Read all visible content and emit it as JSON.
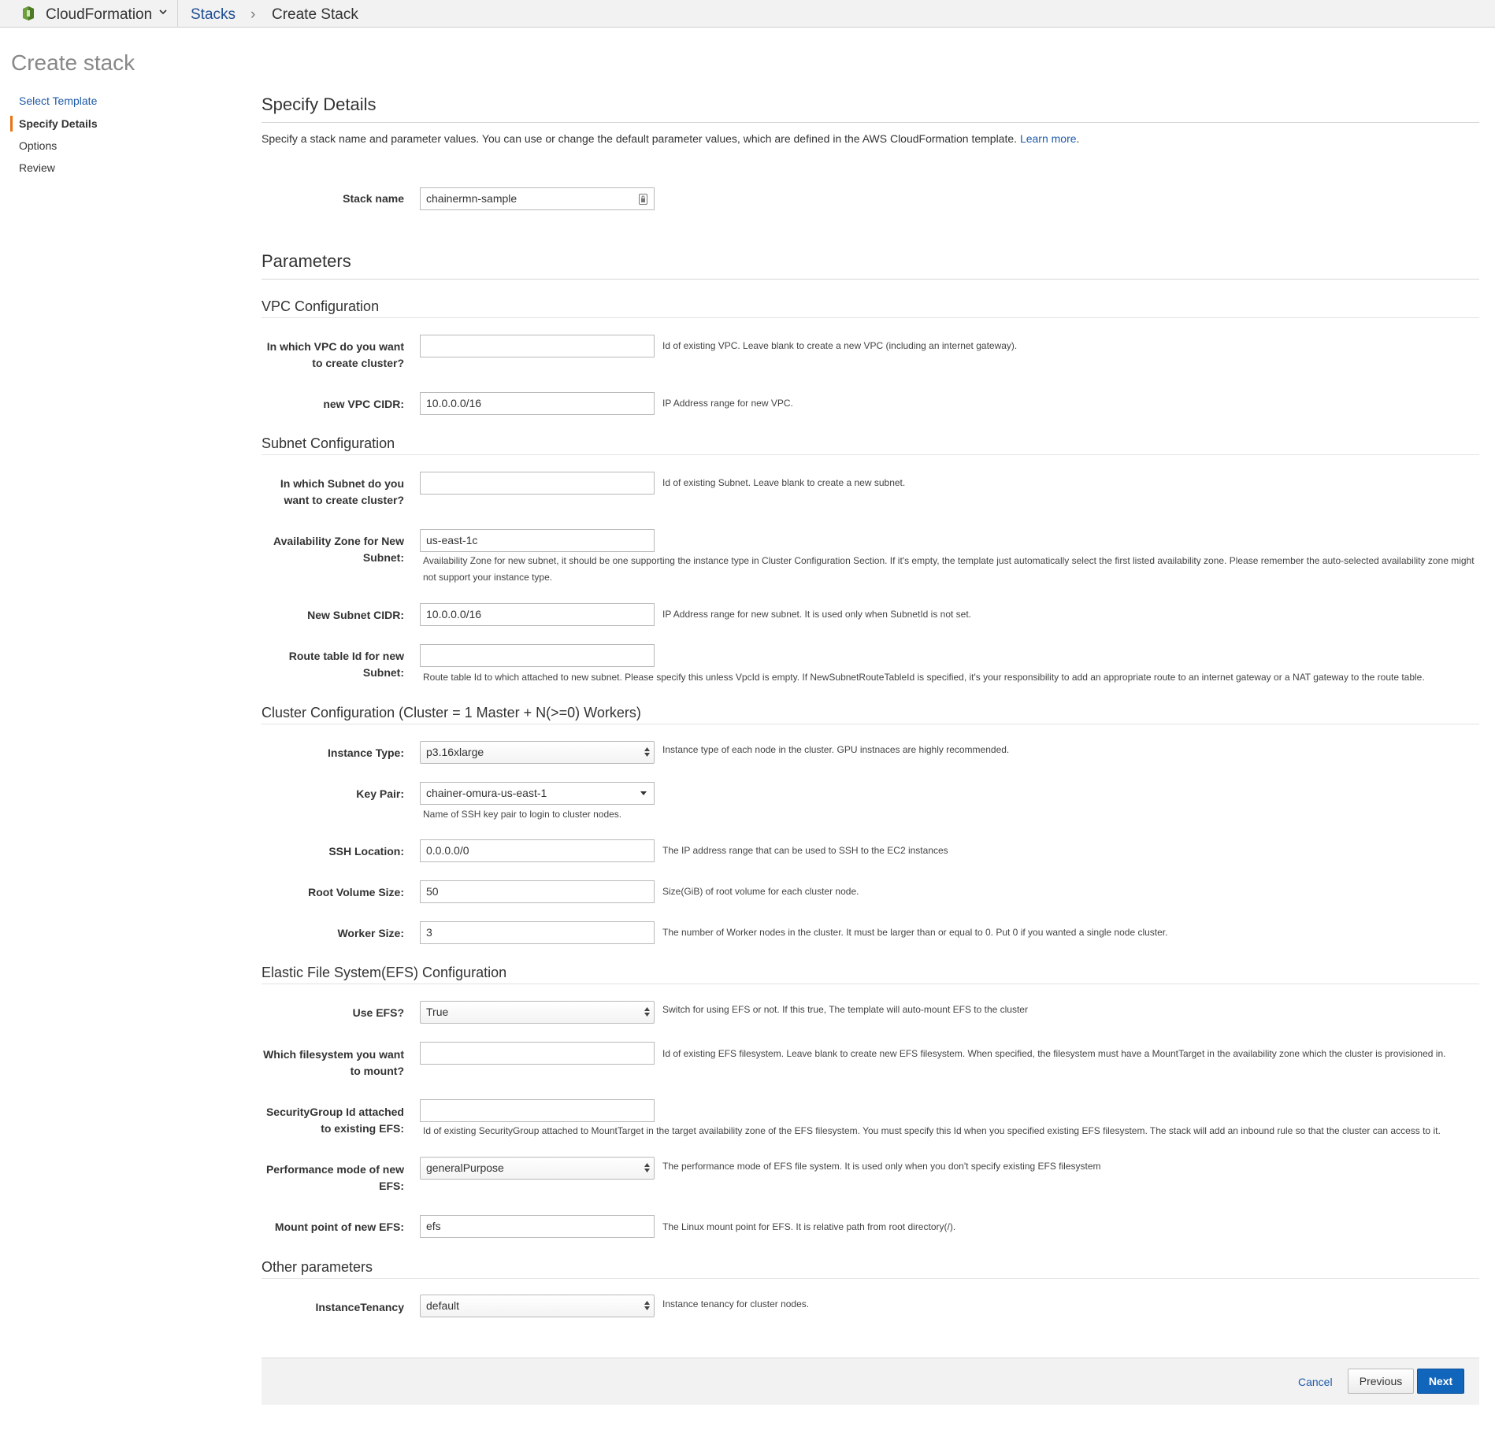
{
  "topbar": {
    "service_name": "CloudFormation",
    "breadcrumb_link": "Stacks",
    "breadcrumb_sep": "›",
    "breadcrumb_current": "Create Stack"
  },
  "page": {
    "title": "Create stack"
  },
  "sidebar": {
    "items": [
      {
        "label": "Select Template"
      },
      {
        "label": "Specify Details"
      },
      {
        "label": "Options"
      },
      {
        "label": "Review"
      }
    ]
  },
  "details": {
    "heading": "Specify Details",
    "intro": "Specify a stack name and parameter values. You can use or change the default parameter values, which are defined in the AWS CloudFormation template.",
    "learn_more": "Learn more",
    "intro_end": ".",
    "stack_name_label": "Stack name",
    "stack_name_value": "chainermn-sample"
  },
  "params": {
    "heading": "Parameters",
    "vpc": {
      "heading": "VPC Configuration",
      "vpc_id_label_1": "In which VPC do you want",
      "vpc_id_label_2": "to create cluster?",
      "vpc_id_value": "",
      "vpc_id_desc": "Id of existing VPC. Leave blank to create a new VPC (including an internet gateway).",
      "cidr_label": "new VPC CIDR:",
      "cidr_value": "10.0.0.0/16",
      "cidr_desc": "IP Address range for new VPC."
    },
    "subnet": {
      "heading": "Subnet Configuration",
      "subnet_id_label_1": "In which Subnet do you",
      "subnet_id_label_2": "want to create cluster?",
      "subnet_id_value": "",
      "subnet_id_desc": "Id of existing Subnet. Leave blank to create a new subnet.",
      "az_label_1": "Availability Zone for New",
      "az_label_2": "Subnet:",
      "az_value": "us-east-1c",
      "az_desc": "Availability Zone for new subnet, it should be one supporting the instance type in Cluster Configuration Section. If it's empty, the template just automatically select the first listed availability zone. Please remember the auto-selected availability zone might not support your instance type.",
      "cidr_label": "New Subnet CIDR:",
      "cidr_value": "10.0.0.0/16",
      "cidr_desc": "IP Address range for new subnet. It is used only when SubnetId is not set.",
      "rt_label_1": "Route table Id for new",
      "rt_label_2": "Subnet:",
      "rt_value": "",
      "rt_desc": "Route table Id to which attached to new subnet. Please specify this unless VpcId is empty. If NewSubnetRouteTableId is specified, it's your responsibility to add an appropriate route to an internet gateway or a NAT gateway to the route table."
    },
    "cluster": {
      "heading": "Cluster Configuration (Cluster = 1 Master + N(>=0) Workers)",
      "instance_label": "Instance Type:",
      "instance_value": "p3.16xlarge",
      "instance_desc": "Instance type of each node in the cluster. GPU instnaces are highly recommended.",
      "key_label": "Key Pair:",
      "key_value": "chainer-omura-us-east-1",
      "key_desc": "Name of SSH key pair to login to cluster nodes.",
      "ssh_label": "SSH Location:",
      "ssh_value": "0.0.0.0/0",
      "ssh_desc": "The IP address range that can be used to SSH to the EC2 instances",
      "root_label": "Root Volume Size:",
      "root_value": "50",
      "root_desc": "Size(GiB) of root volume for each cluster node.",
      "worker_label": "Worker Size:",
      "worker_value": "3",
      "worker_desc": "The number of Worker nodes in the cluster. It must be larger than or equal to 0. Put 0 if you wanted a single node cluster."
    },
    "efs": {
      "heading": "Elastic File System(EFS) Configuration",
      "use_label": "Use EFS?",
      "use_value": "True",
      "use_desc": "Switch for using EFS or not. If this true, The template will auto-mount EFS to the cluster",
      "fs_label_1": "Which filesystem you want",
      "fs_label_2": "to mount?",
      "fs_value": "",
      "fs_desc": "Id of existing EFS filesystem. Leave blank to create new EFS filesystem. When specified, the filesystem must have a MountTarget in the availability zone which the cluster is provisioned in.",
      "sg_label_1": "SecurityGroup Id attached",
      "sg_label_2": "to existing EFS:",
      "sg_value": "",
      "sg_desc": "Id of existing SecurityGroup attached to MountTarget in the target availability zone of the EFS filesystem. You must specify this Id when you specified existing EFS filesystem. The stack will add an inbound rule so that the cluster can access to it.",
      "perf_label_1": "Performance mode of new",
      "perf_label_2": "EFS:",
      "perf_value": "generalPurpose",
      "perf_desc": "The performance mode of EFS file system. It is used only when you don't specify existing EFS filesystem",
      "mount_label": "Mount point of new EFS:",
      "mount_value": "efs",
      "mount_desc": "The Linux mount point for EFS. It is relative path from root directory(/)."
    },
    "other": {
      "heading": "Other parameters",
      "tenancy_label": "InstanceTenancy",
      "tenancy_value": "default",
      "tenancy_desc": "Instance tenancy for cluster nodes."
    }
  },
  "footer": {
    "cancel": "Cancel",
    "previous": "Previous",
    "next": "Next"
  },
  "colors": {
    "link": "#1f5aa8",
    "accent": "#ec7211",
    "primary_button": "#1166bb"
  }
}
